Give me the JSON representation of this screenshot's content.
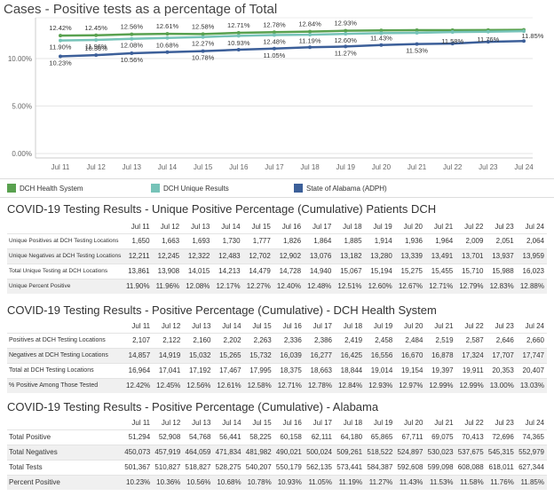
{
  "chart_data": {
    "type": "line",
    "title": "Cases - Positive tests as a percentage of Total",
    "categories": [
      "Jul 11",
      "Jul 12",
      "Jul 13",
      "Jul 14",
      "Jul 15",
      "Jul 16",
      "Jul 17",
      "Jul 18",
      "Jul 19",
      "Jul 20",
      "Jul 21",
      "Jul 22",
      "Jul 23",
      "Jul 24"
    ],
    "ylim": [
      0,
      14
    ],
    "yticks": [
      "10.00%",
      "5.00%",
      "0.00%"
    ],
    "ytick_values": [
      10,
      5,
      0
    ],
    "series": [
      {
        "name": "DCH Health System",
        "color": "#59a14f",
        "values": [
          12.42,
          12.45,
          12.56,
          12.61,
          12.58,
          12.71,
          12.78,
          12.84,
          12.93,
          12.97,
          12.99,
          12.99,
          13.0,
          13.03
        ],
        "labels": [
          "12.42%",
          "12.45%",
          "12.56%",
          "12.61%",
          "12.58%",
          "12.71%",
          "12.78%",
          "12.84%",
          "12.93%",
          "",
          "",
          "",
          "",
          ""
        ]
      },
      {
        "name": "DCH Unique Results",
        "color": "#76c3b8",
        "values": [
          11.9,
          11.96,
          12.08,
          12.17,
          12.27,
          12.4,
          12.48,
          12.51,
          12.6,
          12.67,
          12.71,
          12.79,
          12.83,
          12.88
        ],
        "labels": [
          "11.90%",
          "11.96%",
          "12.08%",
          "",
          "12.27%",
          "",
          "12.48%",
          "",
          "12.60%",
          "",
          "",
          "",
          "",
          ""
        ]
      },
      {
        "name": "State of Alabama (ADPH)",
        "color": "#3c5f99",
        "values": [
          10.23,
          10.36,
          10.56,
          10.68,
          10.78,
          10.93,
          11.05,
          11.19,
          11.27,
          11.43,
          11.53,
          11.58,
          11.76,
          11.85
        ],
        "labels": [
          "10.23%",
          "10.36%",
          "10.56%",
          "10.68%",
          "10.78%",
          "10.93%",
          "11.05%",
          "11.19%",
          "11.27%",
          "11.43%",
          "11.53%",
          "11.58%",
          "11.76%",
          "11.85%"
        ]
      }
    ]
  },
  "legend": [
    {
      "label": "DCH Health System",
      "color": "#59a14f"
    },
    {
      "label": "DCH Unique Results",
      "color": "#76c3b8"
    },
    {
      "label": "State of Alabama (ADPH)",
      "color": "#3c5f99"
    }
  ],
  "table1": {
    "title": "COVID-19 Testing Results - Unique Positive Percentage (Cumulative) Patients DCH",
    "rows": [
      {
        "label": "Unique Positives at DCH Testing Locations",
        "values": [
          "1,650",
          "1,663",
          "1,693",
          "1,730",
          "1,777",
          "1,826",
          "1,864",
          "1,885",
          "1,914",
          "1,936",
          "1,964",
          "2,009",
          "2,051",
          "2,064"
        ]
      },
      {
        "label": "Unique Negatives at DCH Testing Locations",
        "values": [
          "12,211",
          "12,245",
          "12,322",
          "12,483",
          "12,702",
          "12,902",
          "13,076",
          "13,182",
          "13,280",
          "13,339",
          "13,491",
          "13,701",
          "13,937",
          "13,959"
        ]
      },
      {
        "label": "Total Unique Testing at DCH Locations",
        "values": [
          "13,861",
          "13,908",
          "14,015",
          "14,213",
          "14,479",
          "14,728",
          "14,940",
          "15,067",
          "15,194",
          "15,275",
          "15,455",
          "15,710",
          "15,988",
          "16,023"
        ]
      },
      {
        "label": "Unique Percent Positive",
        "values": [
          "11.90%",
          "11.96%",
          "12.08%",
          "12.17%",
          "12.27%",
          "12.40%",
          "12.48%",
          "12.51%",
          "12.60%",
          "12.67%",
          "12.71%",
          "12.79%",
          "12.83%",
          "12.88%"
        ]
      }
    ]
  },
  "table2": {
    "title": "COVID-19 Testing Results - Positive Percentage (Cumulative) - DCH Health System",
    "rows": [
      {
        "label": "Positives at DCH Testing Locations",
        "values": [
          "2,107",
          "2,122",
          "2,160",
          "2,202",
          "2,263",
          "2,336",
          "2,386",
          "2,419",
          "2,458",
          "2,484",
          "2,519",
          "2,587",
          "2,646",
          "2,660"
        ]
      },
      {
        "label": "Negatives at DCH Testing Locations",
        "values": [
          "14,857",
          "14,919",
          "15,032",
          "15,265",
          "15,732",
          "16,039",
          "16,277",
          "16,425",
          "16,556",
          "16,670",
          "16,878",
          "17,324",
          "17,707",
          "17,747"
        ]
      },
      {
        "label": "Total at DCH Testing Locations",
        "values": [
          "16,964",
          "17,041",
          "17,192",
          "17,467",
          "17,995",
          "18,375",
          "18,663",
          "18,844",
          "19,014",
          "19,154",
          "19,397",
          "19,911",
          "20,353",
          "20,407"
        ]
      },
      {
        "label": "% Positive Among Those Tested",
        "values": [
          "12.42%",
          "12.45%",
          "12.56%",
          "12.61%",
          "12.58%",
          "12.71%",
          "12.78%",
          "12.84%",
          "12.93%",
          "12.97%",
          "12.99%",
          "12.99%",
          "13.00%",
          "13.03%"
        ]
      }
    ]
  },
  "table3": {
    "title": "COVID-19 Testing Results - Positive Percentage (Cumulative) - Alabama",
    "rows": [
      {
        "label": "Total Positive",
        "values": [
          "51,294",
          "52,908",
          "54,768",
          "56,441",
          "58,225",
          "60,158",
          "62,111",
          "64,180",
          "65,865",
          "67,711",
          "69,075",
          "70,413",
          "72,696",
          "74,365"
        ]
      },
      {
        "label": "Total Negatives",
        "values": [
          "450,073",
          "457,919",
          "464,059",
          "471,834",
          "481,982",
          "490,021",
          "500,024",
          "509,261",
          "518,522",
          "524,897",
          "530,023",
          "537,675",
          "545,315",
          "552,979"
        ]
      },
      {
        "label": "Total Tests",
        "values": [
          "501,367",
          "510,827",
          "518,827",
          "528,275",
          "540,207",
          "550,179",
          "562,135",
          "573,441",
          "584,387",
          "592,608",
          "599,098",
          "608,088",
          "618,011",
          "627,344"
        ]
      },
      {
        "label": "Percent Positive",
        "values": [
          "10.23%",
          "10.36%",
          "10.56%",
          "10.68%",
          "10.78%",
          "10.93%",
          "11.05%",
          "11.19%",
          "11.27%",
          "11.43%",
          "11.53%",
          "11.58%",
          "11.76%",
          "11.85%"
        ]
      }
    ]
  }
}
